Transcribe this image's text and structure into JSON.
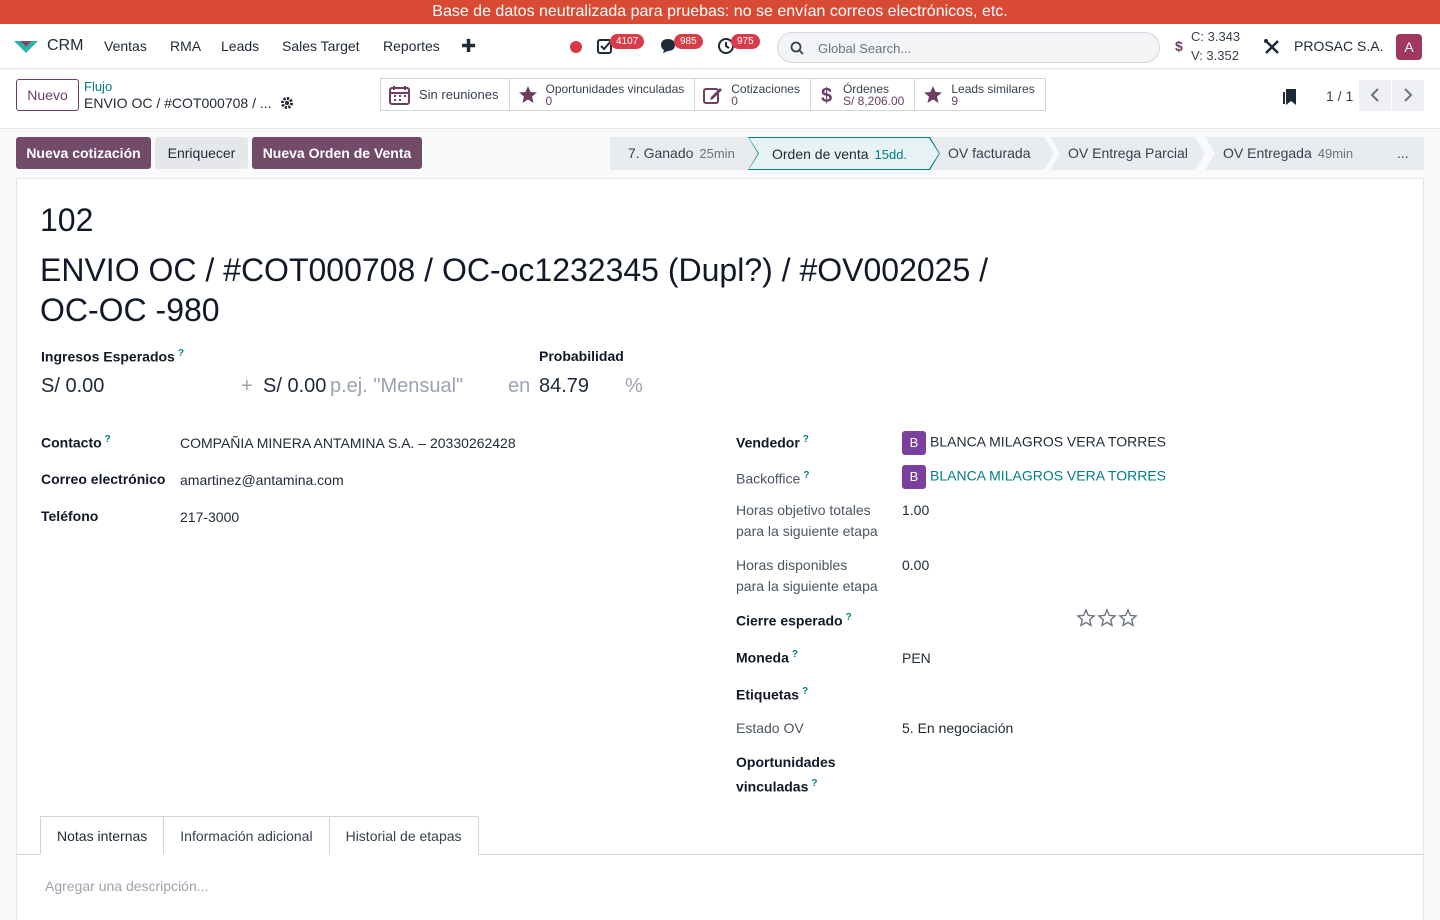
{
  "banner": {
    "text": "Base de datos neutralizada para pruebas: no se envían correos electrónicos, etc."
  },
  "navbar": {
    "app_name": "CRM",
    "menus": [
      "Ventas",
      "RMA",
      "Leads",
      "Sales Target",
      "Reportes"
    ],
    "plus_icon": "plus-icon",
    "activity_badge": "4107",
    "messages_badge": "985",
    "clock_badge": "975",
    "search_placeholder": "Global Search...",
    "fx_compra": "C: 3.343",
    "fx_venta": "V: 3.352",
    "company": "PROSAC S.A.",
    "avatar_letter": "A",
    "colors": {
      "brand": "#714b67",
      "banner": "#d94a35",
      "badge": "#d63c4a",
      "link": "#017e84"
    }
  },
  "control": {
    "new_button": "Nuevo",
    "breadcrumb_parent": "Flujo",
    "breadcrumb_current": "ENVIO OC / #COT000708 / ...",
    "smart_buttons": {
      "meetings": {
        "label": "Sin reuniones",
        "icon": "calendar-icon"
      },
      "linked": {
        "label": "Oportunidades vinculadas",
        "value": "0",
        "icon": "star-icon"
      },
      "quotes": {
        "label": "Cotizaciones",
        "value": "0",
        "icon": "edit-icon"
      },
      "orders": {
        "label": "Órdenes",
        "value": "S/ 8,206.00",
        "icon": "dollar-icon"
      },
      "similar": {
        "label": "Leads similares",
        "value": "9",
        "icon": "star-icon"
      }
    },
    "pager": "1 / 1"
  },
  "actions": {
    "new_quote": "Nueva cotización",
    "enrich": "Enriquecer",
    "new_order": "Nueva Orden de Venta"
  },
  "stages": [
    {
      "name": "7. Ganado",
      "duration": "25min"
    },
    {
      "name": "Orden de venta",
      "duration": "15dd.",
      "active": true
    },
    {
      "name": "OV facturada",
      "duration": ""
    },
    {
      "name": "OV Entrega Parcial",
      "duration": ""
    },
    {
      "name": "OV Entregada",
      "duration": "49min"
    },
    {
      "name": "...",
      "duration": ""
    }
  ],
  "form": {
    "number": "102",
    "title": "ENVIO OC / #COT000708 / OC-oc1232345 (Dupl?) / #OV002025 / OC-OC -980",
    "expected_revenue_label": "Ingresos Esperados",
    "expected_revenue": "S/ 0.00",
    "plus": "+",
    "recurring_revenue": "S/ 0.00",
    "recurring_placeholder": "p.ej. \"Mensual\"",
    "in_word": "en",
    "probability_label": "Probabilidad",
    "probability": "84.79",
    "percent": "%",
    "contact_label": "Contacto",
    "contact": "COMPAÑIA MINERA ANTAMINA S.A. – 20330262428",
    "email_label": "Correo electrónico",
    "email": "amartinez@antamina.com",
    "phone_label": "Teléfono",
    "phone": "217-3000",
    "seller_label": "Vendedor",
    "seller": "BLANCA MILAGROS VERA TORRES",
    "seller_initial": "B",
    "backoffice_label": "Backoffice",
    "backoffice": "BLANCA MILAGROS VERA TORRES",
    "target_hours_label_1": "Horas objetivo totales",
    "target_hours_label_2": "para la siguiente etapa",
    "target_hours": "1.00",
    "available_hours_label_1": "Horas disponibles",
    "available_hours_label_2": "para la siguiente etapa",
    "available_hours": "0.00",
    "expected_close_label": "Cierre esperado",
    "priority_stars": 0,
    "currency_label": "Moneda",
    "currency": "PEN",
    "tags_label": "Etiquetas",
    "ov_state_label": "Estado OV",
    "ov_state": "5. En negociación",
    "linked_opps_label_1": "Oportunidades",
    "linked_opps_label_2": "vinculadas",
    "help_mark": "?"
  },
  "tabs": [
    "Notas internas",
    "Información adicional",
    "Historial de etapas"
  ],
  "notes_placeholder": "Agregar una descripción..."
}
